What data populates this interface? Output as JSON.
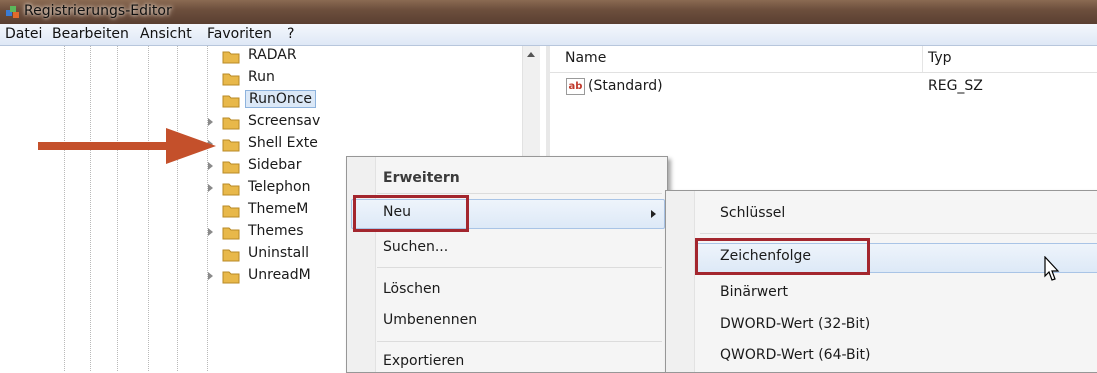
{
  "window": {
    "title": "Registrierungs-Editor"
  },
  "menu": [
    "Datei",
    "Bearbeiten",
    "Ansicht",
    "Favoriten",
    "?"
  ],
  "tree": {
    "nodes": [
      {
        "label": "RADAR"
      },
      {
        "label": "Run"
      },
      {
        "label": "RunOnce"
      },
      {
        "label": "Screensav"
      },
      {
        "label": "Shell Exte"
      },
      {
        "label": "Sidebar"
      },
      {
        "label": "Telephon"
      },
      {
        "label": "ThemeM"
      },
      {
        "label": "Themes"
      },
      {
        "label": "Uninstall"
      },
      {
        "label": "UnreadM"
      }
    ]
  },
  "list": {
    "headers": {
      "name": "Name",
      "type": "Typ"
    },
    "rows": [
      {
        "name": "(Standard)",
        "type": "REG_SZ",
        "icon": "string-value-icon"
      }
    ]
  },
  "context_menu": {
    "items": [
      "Erweitern",
      "Neu",
      "Suchen...",
      "Löschen",
      "Umbenennen",
      "Exportieren"
    ]
  },
  "submenu": {
    "items": [
      "Schlüssel",
      "Zeichenfolge",
      "Binärwert",
      "DWORD-Wert (32-Bit)",
      "QWORD-Wert (64-Bit)"
    ]
  },
  "colors": {
    "annotation_red": "#a3262e",
    "arrow_orange": "#c4502b",
    "folder_yellow": "#e8b84a"
  }
}
